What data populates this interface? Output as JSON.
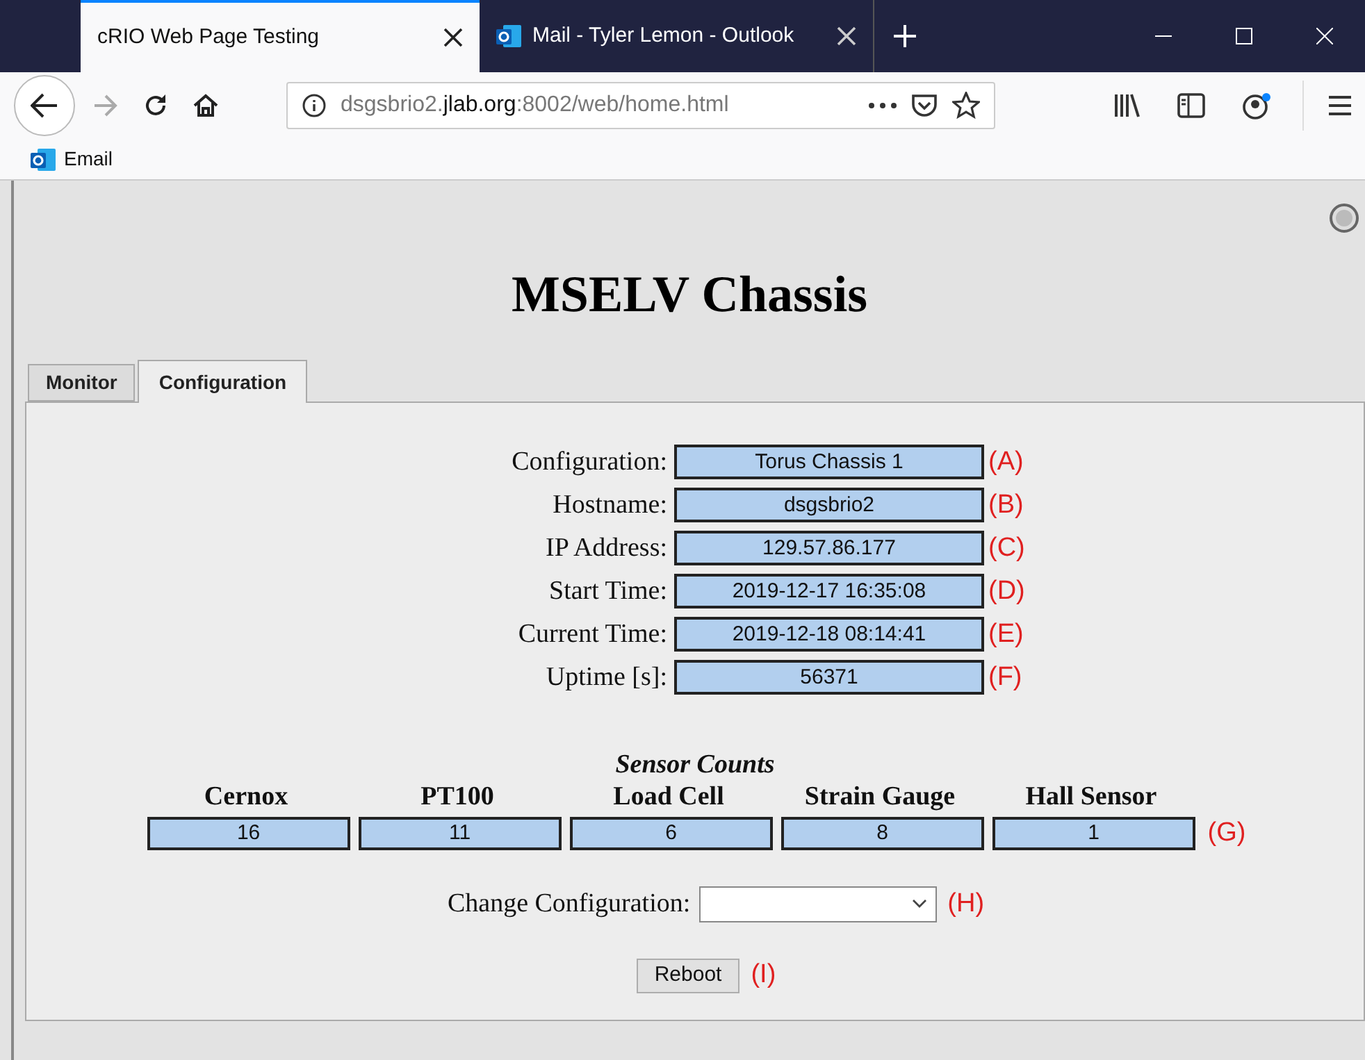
{
  "browser_tabs": [
    {
      "title": "cRIO Web Page Testing",
      "selected": true,
      "kind": "page"
    },
    {
      "title": "Mail - Tyler Lemon - Outlook",
      "selected": false,
      "kind": "mail"
    }
  ],
  "address_bar": {
    "host_prefix": "dsgsbrio2.",
    "domain": "jlab.org",
    "path": ":8002/web/home.html"
  },
  "bookmarks": [
    {
      "label": "Email"
    }
  ],
  "page": {
    "title": "MSELV Chassis",
    "tabs": [
      {
        "label": "Monitor",
        "selected": false
      },
      {
        "label": "Configuration",
        "selected": true
      }
    ],
    "fields": [
      {
        "label": "Configuration:",
        "value": "Torus Chassis 1",
        "note": "(A)"
      },
      {
        "label": "Hostname:",
        "value": "dsgsbrio2",
        "note": "(B)"
      },
      {
        "label": "IP Address:",
        "value": "129.57.86.177",
        "note": "(C)"
      },
      {
        "label": "Start Time:",
        "value": "2019-12-17 16:35:08",
        "note": "(D)"
      },
      {
        "label": "Current Time:",
        "value": "2019-12-18 08:14:41",
        "note": "(E)"
      },
      {
        "label": "Uptime [s]:",
        "value": "56371",
        "note": "(F)"
      }
    ],
    "sensor_counts": {
      "title": "Sensor Counts",
      "note": "(G)",
      "columns": [
        {
          "name": "Cernox",
          "value": "16"
        },
        {
          "name": "PT100",
          "value": "11"
        },
        {
          "name": "Load Cell",
          "value": "6"
        },
        {
          "name": "Strain Gauge",
          "value": "8"
        },
        {
          "name": "Hall Sensor",
          "value": "1"
        }
      ]
    },
    "change_configuration": {
      "label": "Change Configuration:",
      "note": "(H)"
    },
    "reboot": {
      "label": "Reboot",
      "note": "(I)"
    }
  }
}
